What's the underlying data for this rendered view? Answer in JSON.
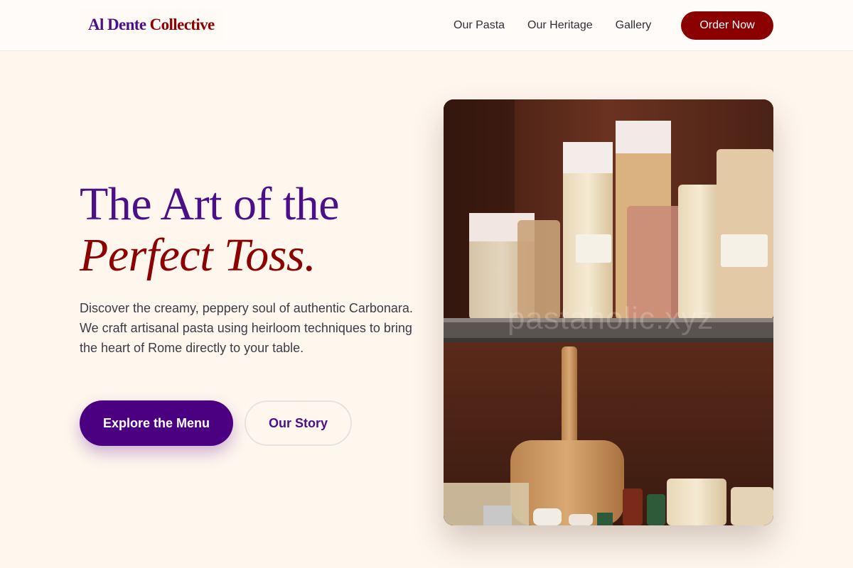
{
  "header": {
    "logo_part1": "Al Dente",
    "logo_part2": "Collective",
    "nav": [
      "Our Pasta",
      "Our Heritage",
      "Gallery"
    ],
    "order_button": "Order Now"
  },
  "hero": {
    "title_line1": "The Art of the",
    "title_line2": "Perfect Toss.",
    "description": "Discover the creamy, peppery soul of authentic Carbonara. We craft artisanal pasta using heirloom techniques to bring the heart of Rome directly to your table.",
    "primary_button": "Explore the Menu",
    "secondary_button": "Our Story",
    "image_watermark": "pastaholic.xyz"
  },
  "colors": {
    "primary_purple": "#4b0082",
    "accent_red": "#8b0000",
    "background": "#fff6ee"
  }
}
